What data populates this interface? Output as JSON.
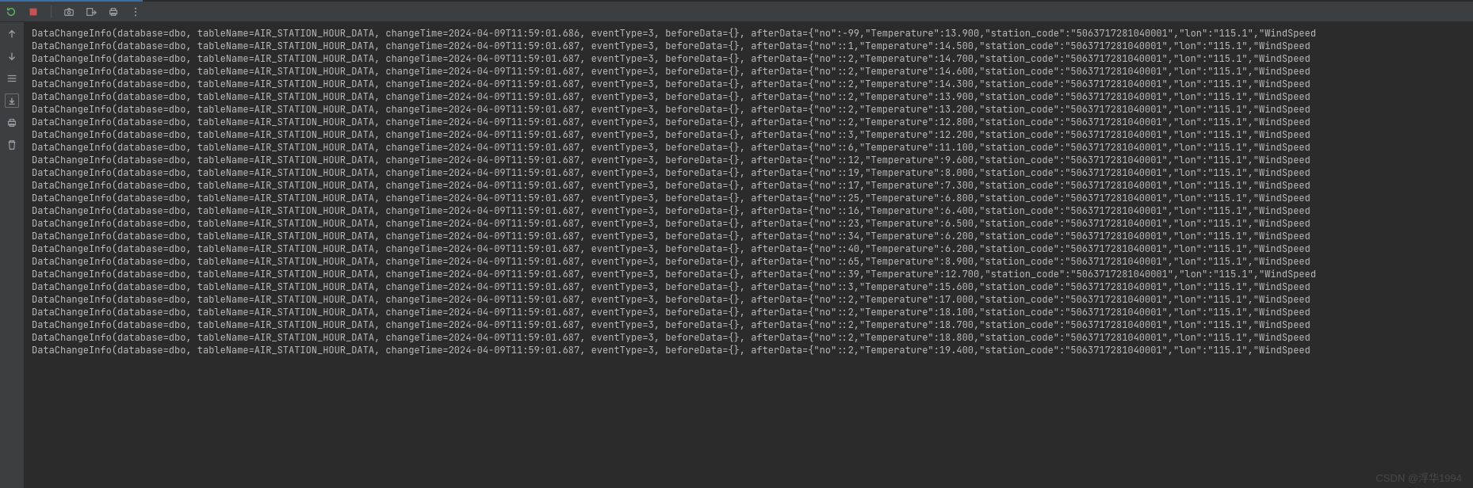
{
  "toolbar": {
    "rerun_icon": "rerun-icon",
    "stop_icon": "stop-icon",
    "camera_icon": "camera-icon",
    "export_icon": "export-icon",
    "print_icon": "print-icon",
    "more_icon": "more-icon"
  },
  "gutter": {
    "up_icon": "arrow-up-icon",
    "down_icon": "arrow-down-icon",
    "wrap_icon": "soft-wrap-icon",
    "scroll_icon": "scroll-to-end-icon",
    "print_icon": "print-icon",
    "trash_icon": "trash-icon"
  },
  "log_template": {
    "prefix": "DataChangeInfo(database=dbo, tableName=AIR_STATION_HOUR_DATA, changeTime=",
    "mid1": ", eventType=3, beforeData={}, afterData={\"no\":",
    "mid2": ",\"Temperature\":",
    "mid3": ",\"station_code\":\"5063717281040001\",\"lon\":\"115.1\",\"WindSpeed"
  },
  "log_rows": [
    {
      "time": "2024-04-09T11:59:01.686",
      "no": "-99",
      "temp": "13.900"
    },
    {
      "time": "2024-04-09T11:59:01.687",
      "no": ":1",
      "temp": "14.500"
    },
    {
      "time": "2024-04-09T11:59:01.687",
      "no": ":2",
      "temp": "14.700"
    },
    {
      "time": "2024-04-09T11:59:01.687",
      "no": ":2",
      "temp": "14.600"
    },
    {
      "time": "2024-04-09T11:59:01.687",
      "no": ":2",
      "temp": "14.300"
    },
    {
      "time": "2024-04-09T11:59:01.687",
      "no": ":2",
      "temp": "13.900"
    },
    {
      "time": "2024-04-09T11:59:01.687",
      "no": ":2",
      "temp": "13.200"
    },
    {
      "time": "2024-04-09T11:59:01.687",
      "no": ":2",
      "temp": "12.800"
    },
    {
      "time": "2024-04-09T11:59:01.687",
      "no": ":3",
      "temp": "12.200"
    },
    {
      "time": "2024-04-09T11:59:01.687",
      "no": ":6",
      "temp": "11.100"
    },
    {
      "time": "2024-04-09T11:59:01.687",
      "no": ":12",
      "temp": "9.600"
    },
    {
      "time": "2024-04-09T11:59:01.687",
      "no": ":19",
      "temp": "8.000"
    },
    {
      "time": "2024-04-09T11:59:01.687",
      "no": ":17",
      "temp": "7.300"
    },
    {
      "time": "2024-04-09T11:59:01.687",
      "no": ":25",
      "temp": "6.800"
    },
    {
      "time": "2024-04-09T11:59:01.687",
      "no": ":16",
      "temp": "6.400"
    },
    {
      "time": "2024-04-09T11:59:01.687",
      "no": ":23",
      "temp": "6.500"
    },
    {
      "time": "2024-04-09T11:59:01.687",
      "no": ":34",
      "temp": "6.200"
    },
    {
      "time": "2024-04-09T11:59:01.687",
      "no": ":40",
      "temp": "6.200"
    },
    {
      "time": "2024-04-09T11:59:01.687",
      "no": ":65",
      "temp": "8.900"
    },
    {
      "time": "2024-04-09T11:59:01.687",
      "no": ":39",
      "temp": "12.700"
    },
    {
      "time": "2024-04-09T11:59:01.687",
      "no": ":3",
      "temp": "15.600"
    },
    {
      "time": "2024-04-09T11:59:01.687",
      "no": ":2",
      "temp": "17.000"
    },
    {
      "time": "2024-04-09T11:59:01.687",
      "no": ":2",
      "temp": "18.100"
    },
    {
      "time": "2024-04-09T11:59:01.687",
      "no": ":2",
      "temp": "18.700"
    },
    {
      "time": "2024-04-09T11:59:01.687",
      "no": ":2",
      "temp": "18.800"
    },
    {
      "time": "2024-04-09T11:59:01.687",
      "no": ":2",
      "temp": "19.400"
    }
  ],
  "watermark": "CSDN @浮华1994"
}
